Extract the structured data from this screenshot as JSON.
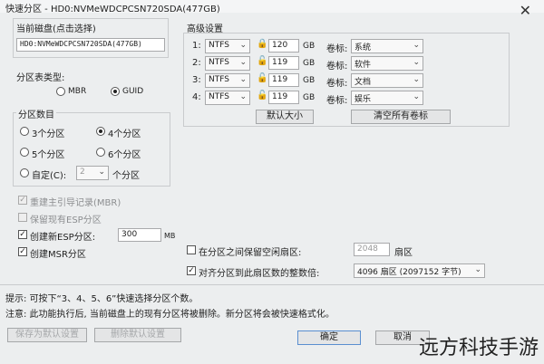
{
  "window": {
    "title": "快速分区 - HD0:NVMeWDCPCSN720SDA(477GB)",
    "close_icon": "close-icon"
  },
  "current_disk": {
    "heading": "当前磁盘(点击选择)",
    "value": "HD0:NVMeWDCPCSN720SDA(477GB)"
  },
  "table_type": {
    "heading": "分区表类型:",
    "options": [
      "MBR",
      "GUID"
    ],
    "selected": "GUID"
  },
  "partition_count": {
    "heading": "分区数目",
    "options": [
      "3个分区",
      "4个分区",
      "5个分区",
      "6个分区"
    ],
    "selected": "4个分区",
    "custom_label": "自定(C):",
    "custom_value": "2",
    "custom_suffix": "个分区"
  },
  "options": {
    "rebuild_mbr": "重建主引导记录(MBR)",
    "keep_esp": "保留现有ESP分区",
    "create_esp": "创建新ESP分区:",
    "esp_size": "300",
    "esp_unit": "MB",
    "create_msr": "创建MSR分区"
  },
  "advanced": {
    "heading": "高级设置",
    "rows": [
      {
        "num": "1:",
        "fs": "NTFS",
        "size": "120",
        "unit": "GB",
        "vol_label": "卷标:",
        "name": "系统"
      },
      {
        "num": "2:",
        "fs": "NTFS",
        "size": "119",
        "unit": "GB",
        "vol_label": "卷标:",
        "name": "软件"
      },
      {
        "num": "3:",
        "fs": "NTFS",
        "size": "119",
        "unit": "GB",
        "vol_label": "卷标:",
        "name": "文档"
      },
      {
        "num": "4:",
        "fs": "NTFS",
        "size": "119",
        "unit": "GB",
        "vol_label": "卷标:",
        "name": "娱乐"
      }
    ],
    "default_size_btn": "默认大小",
    "clear_labels_btn": "清空所有卷标"
  },
  "reserve": {
    "label": "在分区之间保留空闲扇区:",
    "value": "2048",
    "unit": "扇区"
  },
  "align": {
    "label": "对齐分区到此扇区数的整数倍:",
    "value": "4096 扇区 (2097152 字节)"
  },
  "hints": {
    "tip": "提示: 可按下“3、4、5、6”快速选择分区个数。",
    "note": "注意: 此功能执行后, 当前磁盘上的现有分区将被删除。新分区将会被快速格式化。"
  },
  "buttons": {
    "save_default": "保存为默认设置",
    "delete_default": "删除默认设置",
    "ok": "确定",
    "cancel": "取消"
  },
  "watermark": "远方科技手游"
}
